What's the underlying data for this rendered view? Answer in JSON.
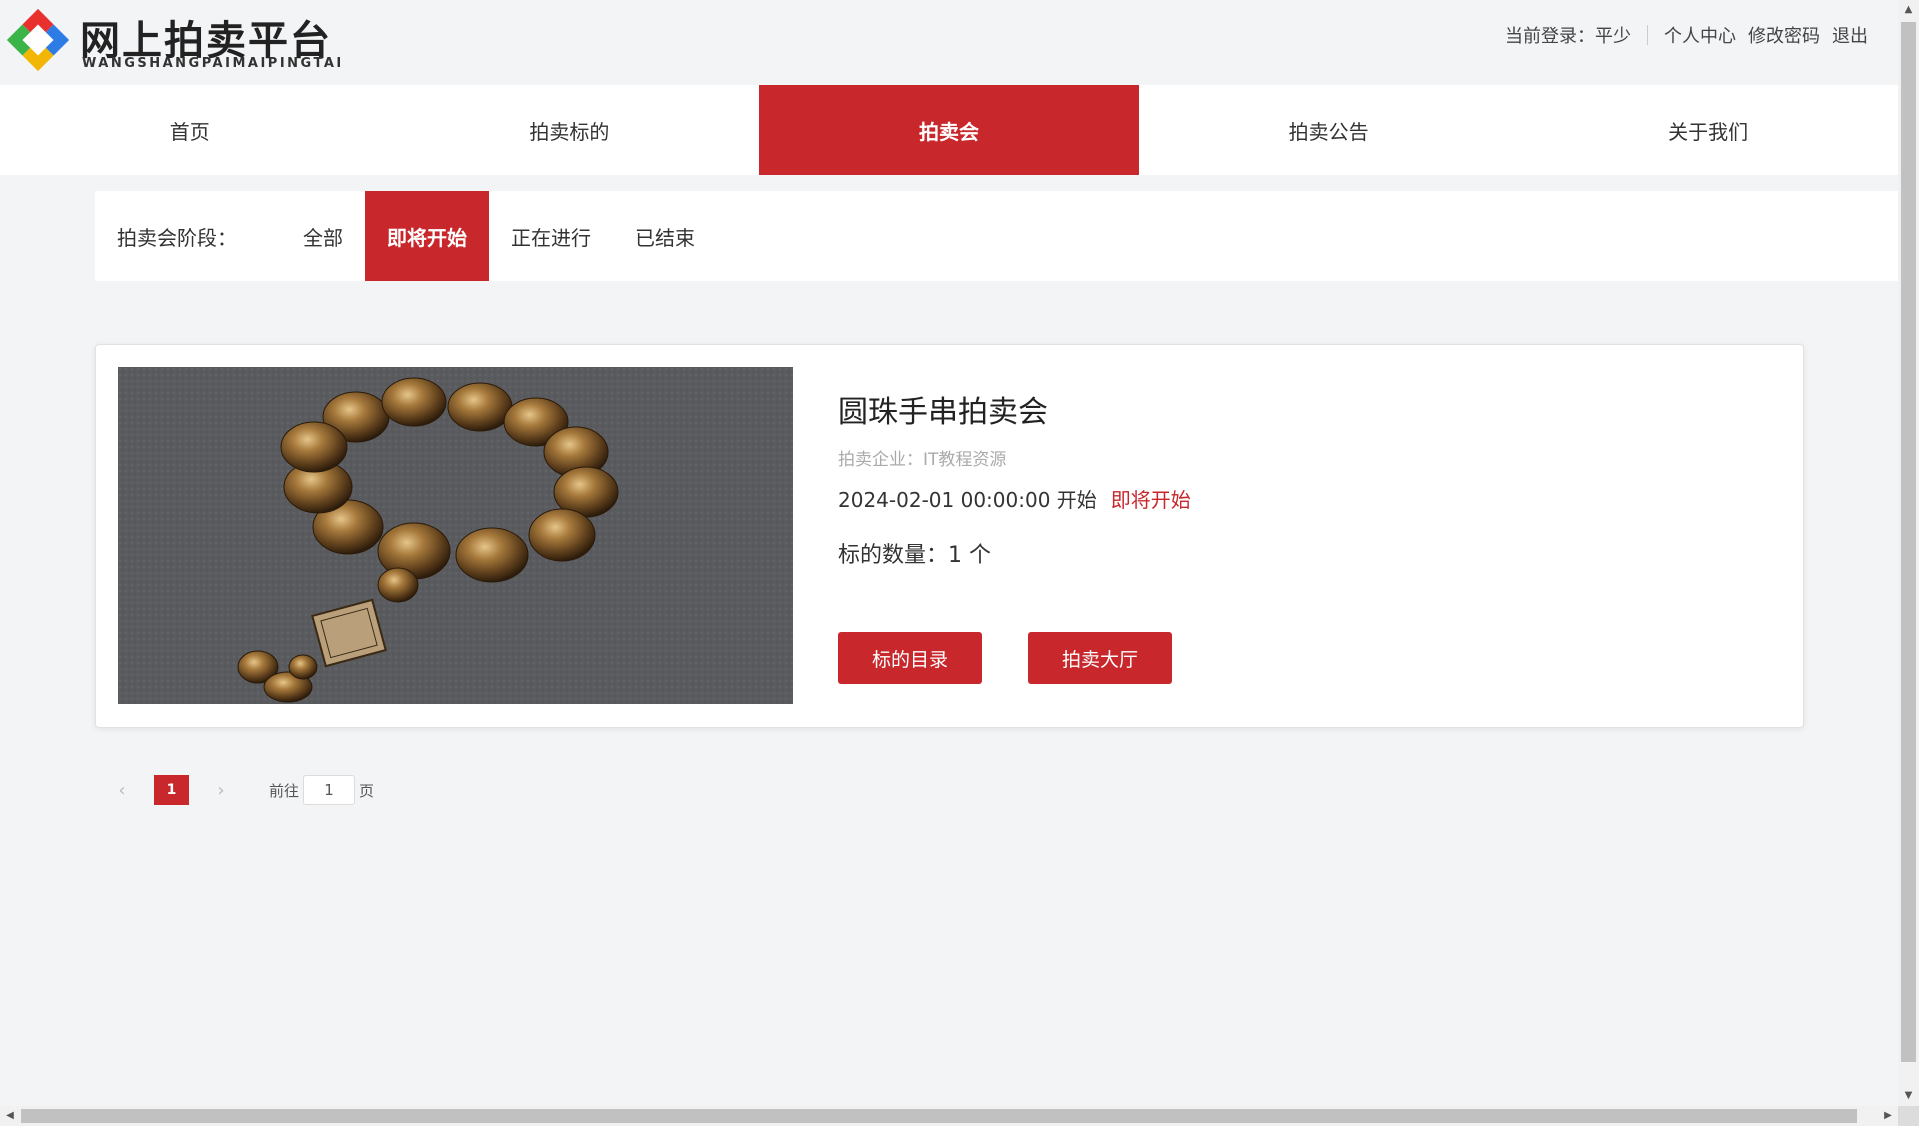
{
  "header": {
    "logo_title": "网上拍卖平台",
    "logo_subtitle": "WANGSHANGPAIMAIPINGTAI",
    "current_login_label": "当前登录：",
    "username": "平少",
    "links": {
      "personal_center": "个人中心",
      "change_password": "修改密码",
      "logout": "退出"
    }
  },
  "nav": {
    "items": [
      {
        "label": "首页",
        "active": false
      },
      {
        "label": "拍卖标的",
        "active": false
      },
      {
        "label": "拍卖会",
        "active": true
      },
      {
        "label": "拍卖公告",
        "active": false
      },
      {
        "label": "关于我们",
        "active": false
      }
    ]
  },
  "stage": {
    "label": "拍卖会阶段：",
    "tabs": [
      {
        "label": "全部",
        "active": false
      },
      {
        "label": "即将开始",
        "active": true
      },
      {
        "label": "正在进行",
        "active": false
      },
      {
        "label": "已结束",
        "active": false
      }
    ]
  },
  "auction": {
    "title": "圆珠手串拍卖会",
    "company": "拍卖企业：IT教程资源",
    "start_time": "2024-02-01 00:00:00 开始",
    "status": "即将开始",
    "count": "标的数量：1 个",
    "buttons": {
      "catalog": "标的目录",
      "hall": "拍卖大厅"
    }
  },
  "pagination": {
    "prev": "‹",
    "next": "›",
    "current_page": "1",
    "goto_label": "前往",
    "goto_value": "1",
    "page_suffix": "页"
  },
  "colors": {
    "accent": "#c8282c",
    "background": "#f3f4f6"
  }
}
